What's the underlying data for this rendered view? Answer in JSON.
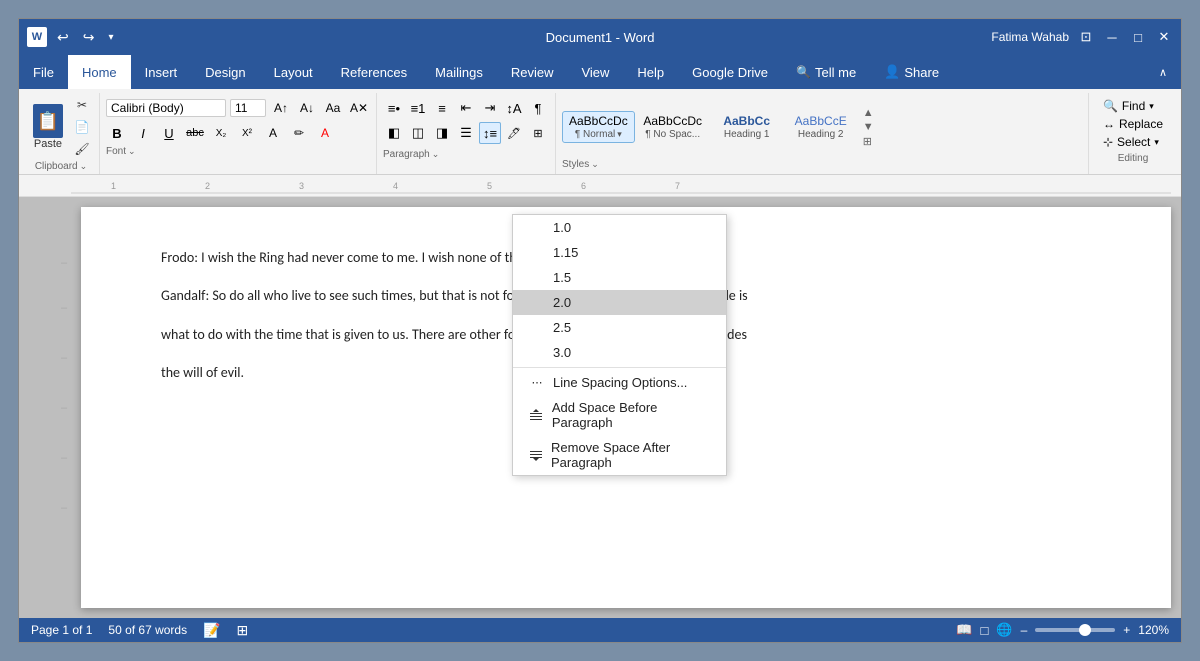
{
  "titlebar": {
    "title": "Document1 - Word",
    "user": "Fatima Wahab",
    "minimize": "─",
    "maximize": "□",
    "close": "✕"
  },
  "menubar": {
    "items": [
      {
        "label": "File",
        "active": false
      },
      {
        "label": "Home",
        "active": true
      },
      {
        "label": "Insert",
        "active": false
      },
      {
        "label": "Design",
        "active": false
      },
      {
        "label": "Layout",
        "active": false
      },
      {
        "label": "References",
        "active": false
      },
      {
        "label": "Mailings",
        "active": false
      },
      {
        "label": "Review",
        "active": false
      },
      {
        "label": "View",
        "active": false
      },
      {
        "label": "Help",
        "active": false
      },
      {
        "label": "Google Drive",
        "active": false
      },
      {
        "label": "Tell me",
        "active": false
      },
      {
        "label": "Share",
        "active": false
      }
    ]
  },
  "ribbon": {
    "font_name": "Calibri (Body)",
    "font_size": "11",
    "styles": [
      {
        "label": "¶ Normal",
        "tag": "AaBbCcDc",
        "active": true
      },
      {
        "label": "¶ No Spac...",
        "tag": "AaBbCcDc",
        "active": false
      },
      {
        "label": "Heading 1",
        "tag": "AaBbCc",
        "active": false
      },
      {
        "label": "Heading 2",
        "tag": "AaBbCcE",
        "active": false
      }
    ],
    "clipboard_label": "Clipboard",
    "font_label": "Font",
    "para_label": "Paragraph",
    "styles_label": "Styles",
    "editing_label": "Editing",
    "find_label": "Find",
    "replace_label": "Replace",
    "select_label": "Select"
  },
  "dropdown": {
    "items": [
      {
        "value": "1.0",
        "label": "1.0",
        "selected": false
      },
      {
        "value": "1.15",
        "label": "1.15",
        "selected": false
      },
      {
        "value": "1.5",
        "label": "1.5",
        "selected": false
      },
      {
        "value": "2.0",
        "label": "2.0",
        "selected": true
      },
      {
        "value": "2.5",
        "label": "2.5",
        "selected": false
      },
      {
        "value": "3.0",
        "label": "3.0",
        "selected": false
      }
    ],
    "options": [
      {
        "label": "Line Spacing Options...",
        "icon": ""
      },
      {
        "label": "Add Space Before Paragraph",
        "icon": "↑"
      },
      {
        "label": "Remove Space After Paragraph",
        "icon": "↓"
      }
    ]
  },
  "document": {
    "lines": [
      "Frodo: I wish the Ring had never come to me. I wish none of this had happened.",
      "Gandalf: So do all who live to see such times, but that is not for them to decide. All we have to decide is",
      "what to do with the time that is given to us. There are other forces at work in this world, Frodo, besides",
      "the will of evil."
    ]
  },
  "statusbar": {
    "page": "Page 1 of 1",
    "words": "50 of 67 words",
    "zoom": "120%"
  }
}
